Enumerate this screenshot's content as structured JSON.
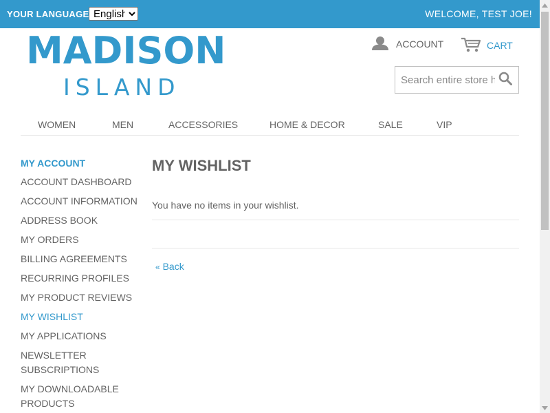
{
  "header": {
    "language_label": "YOUR LANGUAGE:",
    "language_selected": "English",
    "language_options": [
      "English"
    ],
    "welcome": "WELCOME, TEST JOE!",
    "brand_color": "#3399cc"
  },
  "logo": {
    "line1": "MADISON",
    "line2": "ISLAND"
  },
  "account": {
    "label": "ACCOUNT",
    "icon": "user-icon"
  },
  "cart": {
    "label": "CART",
    "icon": "cart-icon"
  },
  "search": {
    "placeholder": "Search entire store here...",
    "value": "",
    "icon": "search-icon"
  },
  "nav": {
    "items": [
      {
        "label": "WOMEN"
      },
      {
        "label": "MEN"
      },
      {
        "label": "ACCESSORIES"
      },
      {
        "label": "HOME & DECOR"
      },
      {
        "label": "SALE"
      },
      {
        "label": "VIP"
      }
    ]
  },
  "sidebar": {
    "title": "MY ACCOUNT",
    "items": [
      {
        "label": "ACCOUNT DASHBOARD"
      },
      {
        "label": "ACCOUNT INFORMATION"
      },
      {
        "label": "ADDRESS BOOK"
      },
      {
        "label": "MY ORDERS"
      },
      {
        "label": "BILLING AGREEMENTS"
      },
      {
        "label": "RECURRING PROFILES"
      },
      {
        "label": "MY PRODUCT REVIEWS"
      },
      {
        "label": "MY WISHLIST",
        "active": true
      },
      {
        "label": "MY APPLICATIONS"
      },
      {
        "label": "NEWSLETTER SUBSCRIPTIONS"
      },
      {
        "label": "MY DOWNLOADABLE PRODUCTS"
      }
    ]
  },
  "main": {
    "title": "MY WISHLIST",
    "empty_message": "You have no items in your wishlist.",
    "back_link": "Back",
    "back_prefix": "«"
  },
  "colors": {
    "accent": "#3399cc",
    "text": "#636363",
    "divider": "#e6e6e6"
  }
}
